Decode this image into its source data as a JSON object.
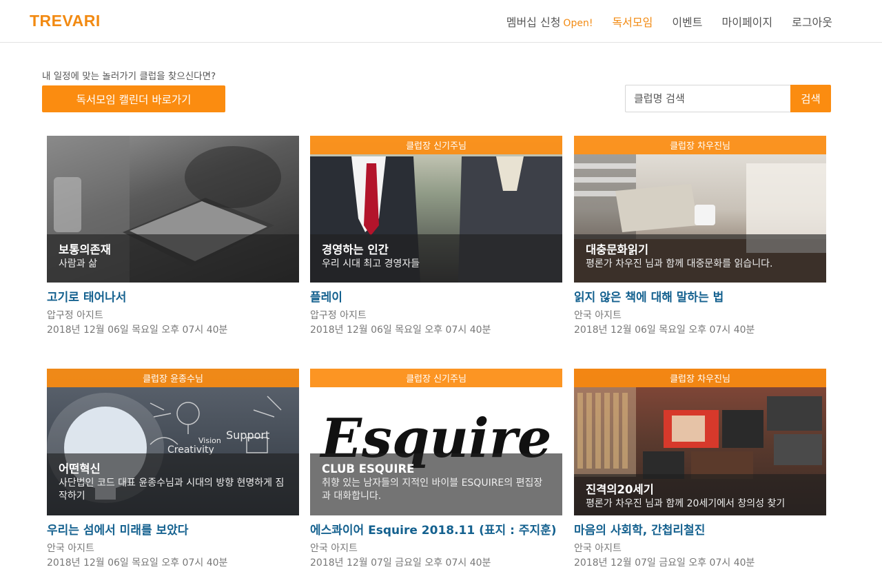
{
  "header": {
    "logo": "TREVARI",
    "nav": {
      "membership": "멤버십 신청",
      "membership_badge": "Open!",
      "book_club": "독서모임",
      "event": "이벤트",
      "mypage": "마이페이지",
      "logout": "로그아웃"
    }
  },
  "controls": {
    "intro": "내 일정에 맞는 놀러가기 클럽을 찾으신다면?",
    "calendar_button": "독서모임 캘린더 바로가기",
    "search_placeholder": "클럽명 검색",
    "search_button": "검색"
  },
  "colors": {
    "accent": "#fb8c10",
    "link": "#14618f"
  },
  "cards": [
    {
      "leader": "",
      "club_title": "보통의존재",
      "club_desc": "사람과 삶",
      "book": "고기로 태어나서",
      "place": "압구정 아지트",
      "date": "2018년 12월 06일 목요일 오후 07시 40분"
    },
    {
      "leader": "클럽장 신기주님",
      "club_title": "경영하는 인간",
      "club_desc": "우리 시대 최고 경영자들",
      "book": "플레이",
      "place": "압구정 아지트",
      "date": "2018년 12월 06일 목요일 오후 07시 40분"
    },
    {
      "leader": "클럽장 차우진님",
      "club_title": "대충문화읽기",
      "club_desc": "평론가 차우진 님과 함께 대중문화를 읽습니다.",
      "book": "읽지 않은 책에 대해 말하는 법",
      "place": "안국 아지트",
      "date": "2018년 12월 06일 목요일 오후 07시 40분"
    },
    {
      "leader": "클럽장 윤종수님",
      "club_title": "어떤혁신",
      "club_desc": "사단법인 코드 대표 윤종수님과 시대의 방향 현명하게 짐작하기",
      "book": "우리는 섬에서 미래를 보았다",
      "place": "안국 아지트",
      "date": "2018년 12월 06일 목요일 오후 07시 40분",
      "image_text": [
        "Vision",
        "Creativity",
        "Support"
      ]
    },
    {
      "leader": "클럽장 신기주님",
      "club_title": "CLUB ESQUIRE",
      "club_desc": "취향 있는 남자들의 지적인 바이블 ESQUIRE의 편집장과 대화합니다.",
      "book": "에스콰이어 Esquire 2018.11 (표지 : 주지훈)",
      "place": "안국 아지트",
      "date": "2018년 12월 07일 금요일 오후 07시 40분",
      "image_text": "Esquire"
    },
    {
      "leader": "클럽장 차우진님",
      "club_title": "진격의20세기",
      "club_desc": "평론가 차우진 님과 함께 20세기에서 창의성 찾기",
      "book": "마음의 사회학, 간첩리철진",
      "place": "안국 아지트",
      "date": "2018년 12월 07일 금요일 오후 07시 40분"
    }
  ]
}
